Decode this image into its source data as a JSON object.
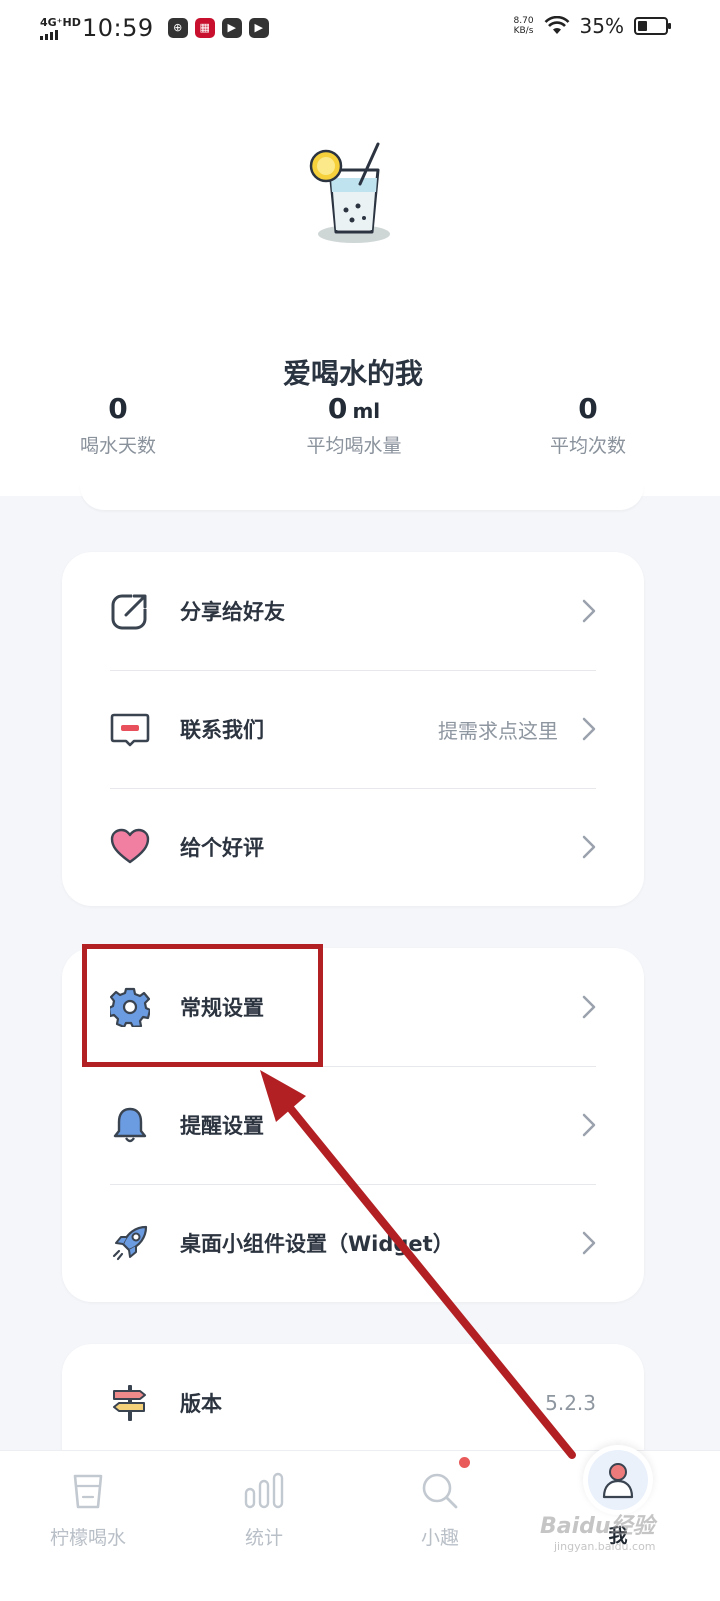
{
  "status_bar": {
    "network": "4G⁺HD",
    "time": "10:59",
    "speed_value": "8.70",
    "speed_unit": "KB/s",
    "battery_pct": "35%",
    "battery_level": 0.35
  },
  "profile": {
    "name": "爱喝水的我",
    "stats": [
      {
        "value": "0",
        "unit": "",
        "label": "喝水天数"
      },
      {
        "value": "0",
        "unit": "ml",
        "label": "平均喝水量"
      },
      {
        "value": "0",
        "unit": "",
        "label": "平均次数"
      }
    ]
  },
  "menu_group_1": [
    {
      "label": "分享给好友",
      "hint": "",
      "icon": "share-icon"
    },
    {
      "label": "联系我们",
      "hint": "提需求点这里",
      "icon": "message-icon"
    },
    {
      "label": "给个好评",
      "hint": "",
      "icon": "heart-icon"
    }
  ],
  "menu_group_2": [
    {
      "label": "常规设置",
      "icon": "gear-icon"
    },
    {
      "label": "提醒设置",
      "icon": "bell-icon"
    },
    {
      "label": "桌面小组件设置（Widget）",
      "icon": "rocket-icon"
    }
  ],
  "menu_group_3": [
    {
      "label": "版本",
      "value": "5.2.3",
      "icon": "signpost-icon"
    }
  ],
  "bottom_nav": [
    {
      "label": "柠檬喝水",
      "icon": "cup-icon",
      "active": false
    },
    {
      "label": "统计",
      "icon": "bars-icon",
      "active": false
    },
    {
      "label": "小趣",
      "icon": "search-icon",
      "active": false,
      "badge": true
    },
    {
      "label": "我",
      "icon": "user-icon",
      "active": true
    }
  ],
  "watermark": {
    "text": "Baidu经验",
    "sub": "jingyan.baidu.com"
  },
  "colors": {
    "accent_blue": "#6b9be0",
    "heart_pink": "#f07fa1",
    "annotation_red": "#b32024",
    "background": "#f4f6fa"
  }
}
